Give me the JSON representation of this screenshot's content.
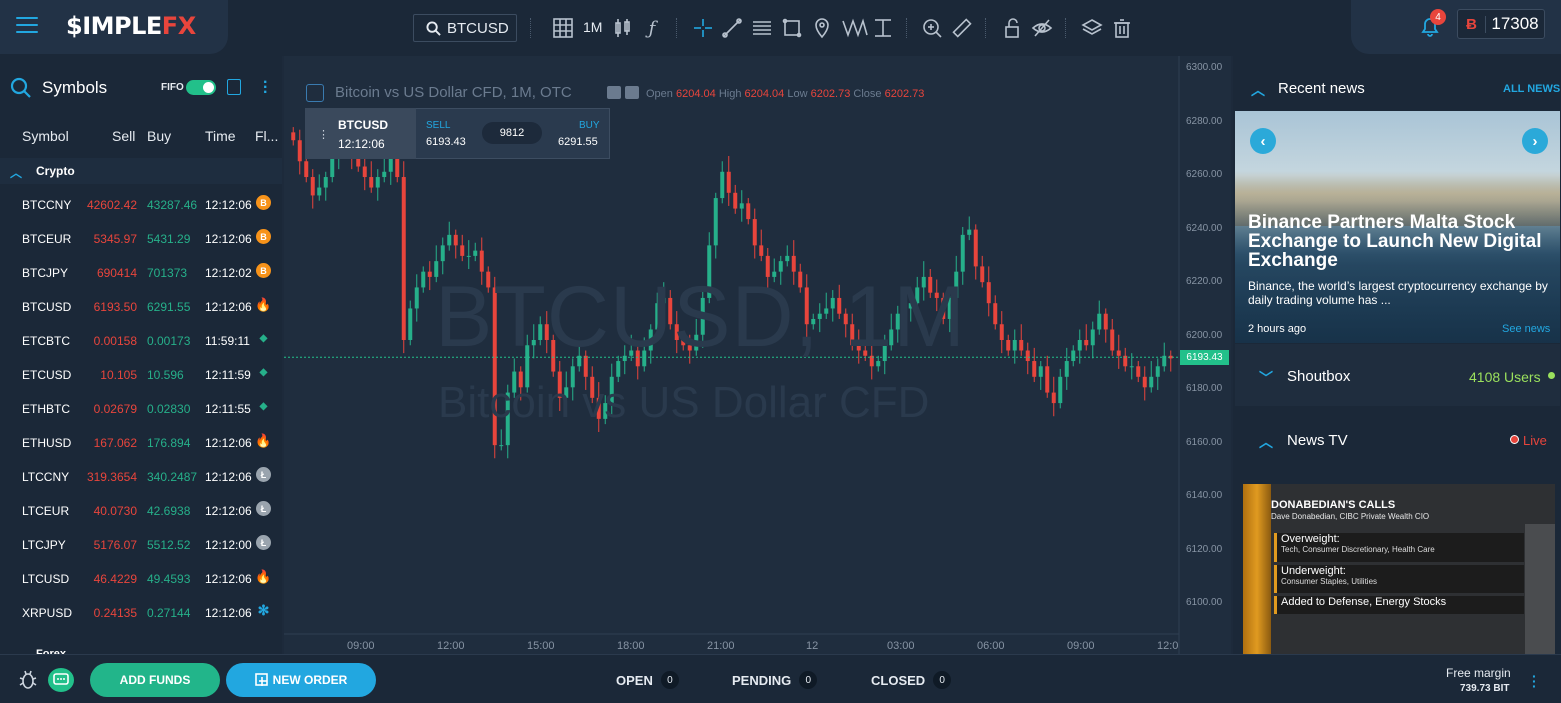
{
  "header": {
    "logo_main": "$IMPLE",
    "logo_accent": "FX",
    "search_symbol": "BTCUSD",
    "timeframe": "1M",
    "notifications_count": "4",
    "balance_currency": "Ƀ",
    "balance_value": "17308"
  },
  "toolbar_icons": [
    "grid-icon",
    "candles-icon",
    "function-icon",
    "crosshair-icon",
    "trendline-icon",
    "fib-icon",
    "rectangle-icon",
    "pin-icon",
    "pattern-icon",
    "measure-icon",
    "zoom-in-icon",
    "ruler-icon",
    "lock-icon",
    "eye-off-icon",
    "layers-icon",
    "trash-icon"
  ],
  "symbols_panel": {
    "title": "Symbols",
    "fifo_label": "FIFO",
    "columns": [
      "Symbol",
      "Sell",
      "Buy",
      "Time",
      "Fl..."
    ],
    "group": "Crypto",
    "next_group": "Forex",
    "rows": [
      {
        "symbol": "BTCCNY",
        "sell": "42602.42",
        "buy": "43287.46",
        "time": "12:12:06",
        "flag": "B",
        "flag_color": "#f7931a"
      },
      {
        "symbol": "BTCEUR",
        "sell": "5345.97",
        "buy": "5431.29",
        "time": "12:12:06",
        "flag": "B",
        "flag_color": "#f7931a"
      },
      {
        "symbol": "BTCJPY",
        "sell": "690414",
        "buy": "701373",
        "time": "12:12:02",
        "flag": "B",
        "flag_color": "#f7931a"
      },
      {
        "symbol": "BTCUSD",
        "sell": "6193.50",
        "buy": "6291.55",
        "time": "12:12:06",
        "flag": "🔥",
        "flag_color": "transparent"
      },
      {
        "symbol": "ETCBTC",
        "sell": "0.00158",
        "buy": "0.00173",
        "time": "11:59:11",
        "flag": "◆",
        "flag_color": "transparent"
      },
      {
        "symbol": "ETCUSD",
        "sell": "10.105",
        "buy": "10.596",
        "time": "12:11:59",
        "flag": "◆",
        "flag_color": "transparent"
      },
      {
        "symbol": "ETHBTC",
        "sell": "0.02679",
        "buy": "0.02830",
        "time": "12:11:55",
        "flag": "◆",
        "flag_color": "transparent"
      },
      {
        "symbol": "ETHUSD",
        "sell": "167.062",
        "buy": "176.894",
        "time": "12:12:06",
        "flag": "🔥",
        "flag_color": "transparent"
      },
      {
        "symbol": "LTCCNY",
        "sell": "319.3654",
        "buy": "340.2487",
        "time": "12:12:06",
        "flag": "Ł",
        "flag_color": "#9aa4ae"
      },
      {
        "symbol": "LTCEUR",
        "sell": "40.0730",
        "buy": "42.6938",
        "time": "12:12:06",
        "flag": "Ł",
        "flag_color": "#9aa4ae"
      },
      {
        "symbol": "LTCJPY",
        "sell": "5176.07",
        "buy": "5512.52",
        "time": "12:12:00",
        "flag": "Ł",
        "flag_color": "#9aa4ae"
      },
      {
        "symbol": "LTCUSD",
        "sell": "46.4229",
        "buy": "49.4593",
        "time": "12:12:06",
        "flag": "🔥",
        "flag_color": "transparent"
      },
      {
        "symbol": "XRPUSD",
        "sell": "0.24135",
        "buy": "0.27144",
        "time": "12:12:06",
        "flag": "✻",
        "flag_color": "transparent"
      }
    ]
  },
  "chart": {
    "title": "Bitcoin vs US Dollar CFD, 1M, OTC",
    "watermark_symbol": "BTCUSD, 1M",
    "watermark_name": "Bitcoin vs US Dollar CFD",
    "ohlc": {
      "open_label": "Open",
      "open": "6204.04",
      "high_label": "High",
      "high": "6204.04",
      "low_label": "Low",
      "low": "6202.73",
      "close_label": "Close",
      "close": "6202.73"
    },
    "last_price": "6193.43",
    "trade_box": {
      "symbol": "BTCUSD",
      "time": "12:12:06",
      "sell_label": "SELL",
      "sell": "6193.43",
      "spread": "9812",
      "buy_label": "BUY",
      "buy": "6291.55"
    },
    "y_ticks": [
      "6300.00",
      "6280.00",
      "6260.00",
      "6240.00",
      "6220.00",
      "6200.00",
      "6180.00",
      "6160.00",
      "6140.00",
      "6120.00",
      "6100.00"
    ],
    "x_ticks": [
      "09:00",
      "12:00",
      "15:00",
      "18:00",
      "21:00",
      "12",
      "03:00",
      "06:00",
      "09:00",
      "12:0"
    ]
  },
  "chart_data": {
    "type": "candlestick",
    "x_label": "",
    "y_label": "",
    "ylim": [
      6095,
      6305
    ],
    "series": [
      {
        "values": [
          6276,
          6268,
          6262,
          6255,
          6258,
          6262,
          6270,
          6278,
          6275,
          6270,
          6266,
          6262,
          6258,
          6262,
          6264,
          6270,
          6262,
          6200,
          6212,
          6220,
          6226,
          6224,
          6230,
          6236,
          6240,
          6236,
          6232,
          6232,
          6234,
          6226,
          6220,
          6160,
          6160,
          6180,
          6188,
          6182,
          6198,
          6200,
          6206,
          6200,
          6188,
          6178,
          6182,
          6190,
          6194,
          6186,
          6178,
          6170,
          6176,
          6186,
          6192,
          6194,
          6196,
          6190,
          6196,
          6204,
          6214,
          6216,
          6206,
          6200,
          6198,
          6196,
          6202,
          6216,
          6236,
          6254,
          6264,
          6256,
          6250,
          6252,
          6246,
          6236,
          6232,
          6224,
          6226,
          6230,
          6232,
          6226,
          6220,
          6206,
          6208,
          6210,
          6212,
          6216,
          6210,
          6206,
          6198,
          6196,
          6194,
          6190,
          6192,
          6198,
          6204,
          6210,
          6212,
          6214,
          6220,
          6224,
          6218,
          6216,
          6208,
          6216,
          6226,
          6240,
          6242,
          6228,
          6222,
          6214,
          6206,
          6200,
          6196,
          6200,
          6196,
          6192,
          6186,
          6190,
          6180,
          6176,
          6186,
          6192,
          6196,
          6200,
          6198,
          6204,
          6210,
          6204,
          6196,
          6194,
          6190,
          6190,
          6186,
          6182,
          6186,
          6190,
          6194,
          6193
        ]
      }
    ]
  },
  "news": {
    "title": "Recent news",
    "all_news": "ALL NEWS",
    "headline": "Binance Partners Malta Stock Exchange to Launch New Digital Exchange",
    "subhead": "Binance, the world’s largest cryptocurrency exchange by daily trading volume has ...",
    "ago": "2 hours ago",
    "see_news": "See news"
  },
  "shoutbox": {
    "title": "Shoutbox",
    "users": "4108 Users"
  },
  "news_tv": {
    "title": "News TV",
    "live": "Live",
    "screen": {
      "h1": "DONABEDIAN'S CALLS",
      "h2": "Dave Donabedian, CIBC Private Wealth CIO",
      "l1a": "Overweight:",
      "l1b": "Tech, Consumer Discretionary, Health Care",
      "l2a": "Underweight:",
      "l2b": "Consumer Staples, Utilities",
      "l3a": "Added to Defense, Energy Stocks"
    }
  },
  "bottom": {
    "add_funds": "ADD FUNDS",
    "new_order": "NEW ORDER",
    "open_label": "OPEN",
    "open_count": "0",
    "pending_label": "PENDING",
    "pending_count": "0",
    "closed_label": "CLOSED",
    "closed_count": "0",
    "free_margin_label": "Free margin",
    "free_margin_value": "739.73 BIT"
  },
  "colors": {
    "accent": "#22a7e0",
    "up": "#26b08a",
    "down": "#e8453c",
    "bg": "#1b2838"
  }
}
